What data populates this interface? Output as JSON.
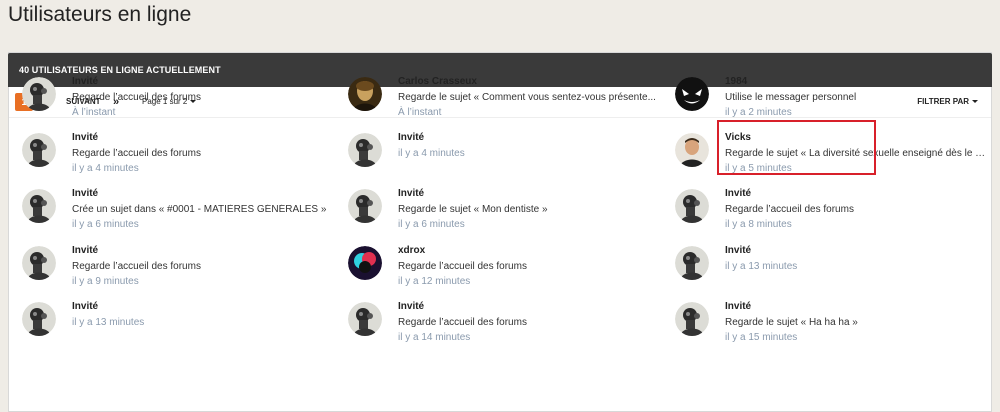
{
  "page": {
    "title": "Utilisateurs en ligne"
  },
  "card": {
    "header": "40 utilisateurs en ligne actuellement"
  },
  "pager": {
    "pages": [
      "1",
      "2"
    ],
    "next": "SUIVANT",
    "last": "»",
    "page_of": "Page 1 sur 2",
    "filter": "FILTRER PAR"
  },
  "users": [
    {
      "name": "Invité",
      "activity": "Regarde l’accueil des forums",
      "time": "À l’instant",
      "avatar": "guest-avatar"
    },
    {
      "name": "Carlos Crasseux",
      "activity": "Regarde le sujet « Comment vous sentez-vous présente...",
      "time": "À l’instant",
      "avatar": "portrait-avatar"
    },
    {
      "name": "1984",
      "activity": "Utilise le messager personnel",
      "time": "il y a 2 minutes",
      "avatar": "venom-avatar"
    },
    {
      "name": "Invité",
      "activity": "Regarde l’accueil des forums",
      "time": "il y a 4 minutes",
      "avatar": "guest-avatar"
    },
    {
      "name": "Invité",
      "activity": "",
      "time": "il y a 4 minutes",
      "avatar": "guest-avatar"
    },
    {
      "name": "Vicks",
      "activity": "Regarde le sujet « La diversité sexuelle enseigné dès le p...",
      "time": "il y a 5 minutes",
      "avatar": "photo-avatar"
    },
    {
      "name": "Invité",
      "activity": "Crée un sujet dans « #0001 - MATIÈRES GÉNÉRALES »",
      "time": "il y a 6 minutes",
      "avatar": "guest-avatar"
    },
    {
      "name": "Invité",
      "activity": "Regarde le sujet « Mon dentiste »",
      "time": "il y a 6 minutes",
      "avatar": "guest-avatar"
    },
    {
      "name": "Invité",
      "activity": "Regarde l’accueil des forums",
      "time": "il y a 8 minutes",
      "avatar": "guest-avatar"
    },
    {
      "name": "Invité",
      "activity": "Regarde l’accueil des forums",
      "time": "il y a 9 minutes",
      "avatar": "guest-avatar"
    },
    {
      "name": "xdrox",
      "activity": "Regarde l’accueil des forums",
      "time": "il y a 12 minutes",
      "avatar": "neon-avatar"
    },
    {
      "name": "Invité",
      "activity": "",
      "time": "il y a 13 minutes",
      "avatar": "guest-avatar"
    },
    {
      "name": "Invité",
      "activity": "",
      "time": "il y a 13 minutes",
      "avatar": "guest-avatar"
    },
    {
      "name": "Invité",
      "activity": "Regarde l’accueil des forums",
      "time": "il y a 14 minutes",
      "avatar": "guest-avatar"
    },
    {
      "name": "Invité",
      "activity": "Regarde le sujet « Ha ha ha »",
      "time": "il y a 15 minutes",
      "avatar": "guest-avatar"
    }
  ],
  "colors": {
    "accent": "#e86f24",
    "header_bg": "#3a3a3a",
    "highlight": "#d8202a",
    "time": "#8a9aad"
  }
}
